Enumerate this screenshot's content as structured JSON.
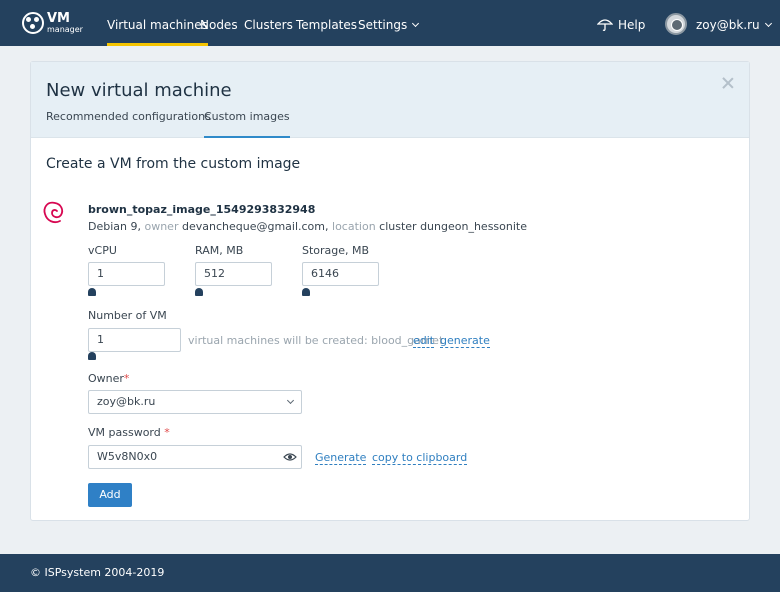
{
  "nav": {
    "logo_main": "VM",
    "logo_sub": "manager",
    "items": [
      "Virtual machines",
      "Nodes",
      "Clusters",
      "Templates",
      "Settings"
    ],
    "help": "Help",
    "user": "zoy@bk.ru",
    "accent_color": "#f5c400",
    "bg_color": "#24415e"
  },
  "dialog": {
    "title": "New virtual machine",
    "tabs": [
      "Recommended configurations",
      "Custom images"
    ],
    "active_tab": "Custom images",
    "section_title": "Create a VM from the custom image"
  },
  "image": {
    "icon": "debian-icon",
    "name": "brown_topaz_image_1549293832948",
    "os": "Debian 9,",
    "owner_label": "owner",
    "owner": "devancheque@gmail.com,",
    "location_label": "location",
    "location": "cluster dungeon_hessonite"
  },
  "form": {
    "vcpu_label": "vCPU",
    "vcpu_value": "1",
    "ram_label": "RAM, MB",
    "ram_value": "512",
    "storage_label": "Storage, MB",
    "storage_value": "6146",
    "count_label": "Number of VM",
    "count_value": "1",
    "count_hint": "virtual machines will be created: blood_garnet",
    "count_edit": "edit",
    "count_generate": "generate",
    "owner_label": "Owner",
    "owner_value": "zoy@bk.ru",
    "password_label": "VM password",
    "password_value": "W5v8N0x0",
    "password_generate": "Generate",
    "password_copy": "copy to clipboard",
    "required_mark": "*",
    "submit": "Add"
  },
  "footer": {
    "copyright": "© ISPsystem 2004-2019"
  }
}
